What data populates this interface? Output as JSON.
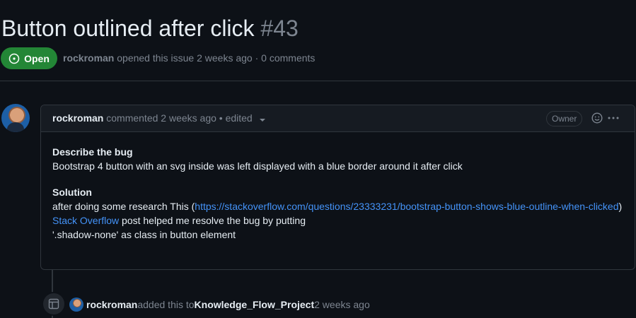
{
  "issue": {
    "title": "Button outlined after click",
    "number": "#43",
    "state_label": "Open",
    "author": "rockroman",
    "meta_text": " opened this issue 2 weeks ago · 0 comments"
  },
  "comment": {
    "author": "rockroman",
    "meta_text": " commented 2 weeks ago • edited",
    "badge": "Owner",
    "heading_bug": "Describe the bug",
    "bug_text": "Bootstrap 4 button with an svg inside was left displayed with a blue border around it after click",
    "heading_solution": "Solution",
    "solution_intro": "after doing some research This (",
    "link_url_text": "https://stackoverflow.com/questions/23333231/bootstrap-button-shows-blue-outline-when-clicked",
    "after_link": ")",
    "link_so": "Stack Overflow",
    "line_after_so": " post helped me resolve the bug by putting",
    "last_line": "'.shadow-none' as class in button element"
  },
  "timeline_event": {
    "actor": "rockroman",
    "text_1": " added this to ",
    "project": "Knowledge_Flow_Project",
    "text_2": " 2 weeks ago"
  },
  "icons": {
    "state": "issue-open-icon",
    "reaction": "smiley-icon",
    "more": "kebab-horizontal-icon",
    "dropdown": "caret-down-icon",
    "project": "table-icon"
  },
  "colors": {
    "background": "#0d1117",
    "open_green": "#238636",
    "link_blue": "#4493f8",
    "muted": "#7d8590",
    "border": "#30363d"
  }
}
